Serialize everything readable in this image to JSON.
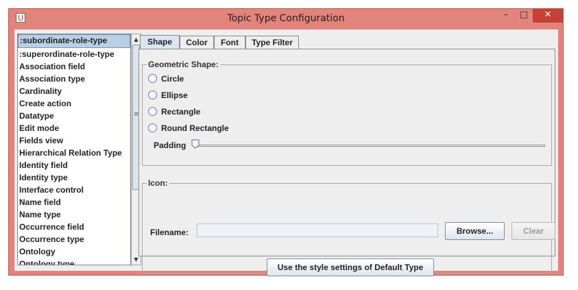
{
  "window": {
    "title": "Topic Type Configuration",
    "controls": {
      "minimize": "–",
      "maximize": "□",
      "close": "✕"
    }
  },
  "type_list": {
    "items": [
      ":subordinate-role-type",
      ":superordinate-role-type",
      "Association field",
      "Association type",
      "Cardinality",
      "Create action",
      "Datatype",
      "Edit mode",
      "Fields view",
      "Hierarchical Relation Type",
      "Identity field",
      "Identity type",
      "Interface control",
      "Name field",
      "Name type",
      "Occurrence field",
      "Occurrence type",
      "Ontology",
      "Ontology type"
    ],
    "selected_index": 0
  },
  "tabs": [
    {
      "label": "Shape",
      "active": true
    },
    {
      "label": "Color",
      "active": false
    },
    {
      "label": "Font",
      "active": false
    },
    {
      "label": "Type Filter",
      "active": false
    }
  ],
  "shape_panel": {
    "geometric_group_title": "Geometric Shape:",
    "options": [
      "Circle",
      "Ellipse",
      "Rectangle",
      "Round Rectangle"
    ],
    "padding_label": "Padding",
    "padding_value": 0
  },
  "icon_panel": {
    "group_title": "Icon:",
    "filename_label": "Filename:",
    "filename_value": "",
    "browse_label": "Browse...",
    "clear_label": "Clear"
  },
  "footer": {
    "default_button_label": "Use the style settings of Default Type"
  },
  "colors": {
    "window_frame": "#e3847c",
    "close_button": "#c74234",
    "selection": "#b8cfe5"
  }
}
